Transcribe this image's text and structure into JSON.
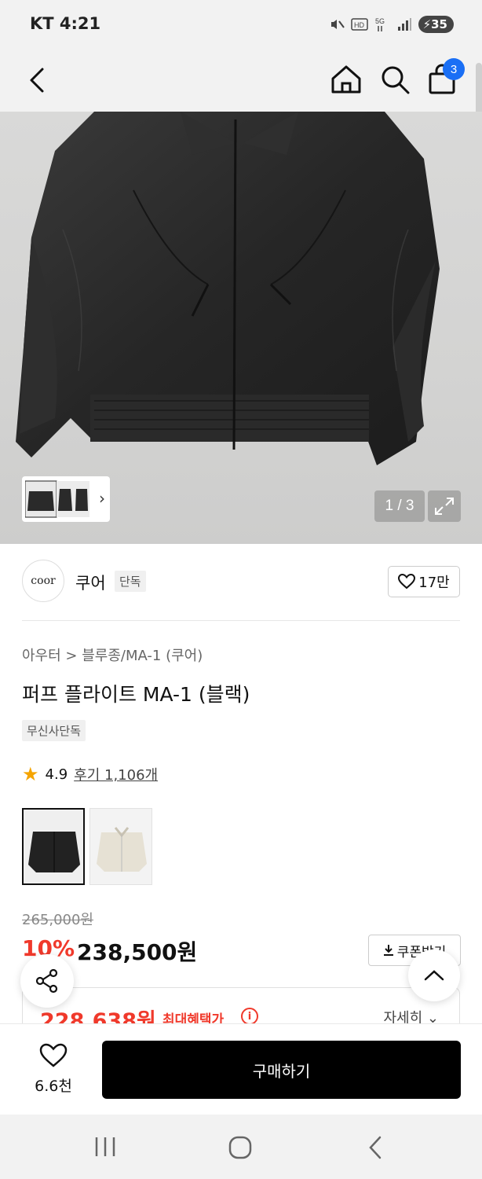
{
  "status_bar": {
    "carrier_time": "KT 4:21",
    "battery": "35"
  },
  "header": {
    "cart_count": "3"
  },
  "gallery": {
    "counter": "1 / 3"
  },
  "brand": {
    "logo_text": "coor",
    "name": "쿠어",
    "exclusive_badge": "단독",
    "likes": "17만"
  },
  "product": {
    "breadcrumb": "아우터 > 블루종/MA-1 (쿠어)",
    "title": "퍼프 플라이트 MA-1 (블랙)",
    "tag": "무신사단독",
    "rating": "4.9",
    "reviews": "후기 1,106개",
    "original_price": "265,000원",
    "discount": "10%",
    "price": "238,500원",
    "coupon_label": "쿠폰받기",
    "max_benefit_price": "228,638원",
    "max_benefit_label": "최대혜택가",
    "detail_label": "자세히"
  },
  "bottom": {
    "wish_count": "6.6천",
    "buy_label": "구매하기"
  },
  "colors": {
    "accent_red": "#f0392b",
    "badge_blue": "#1a6ff5",
    "star": "#f5a400"
  }
}
